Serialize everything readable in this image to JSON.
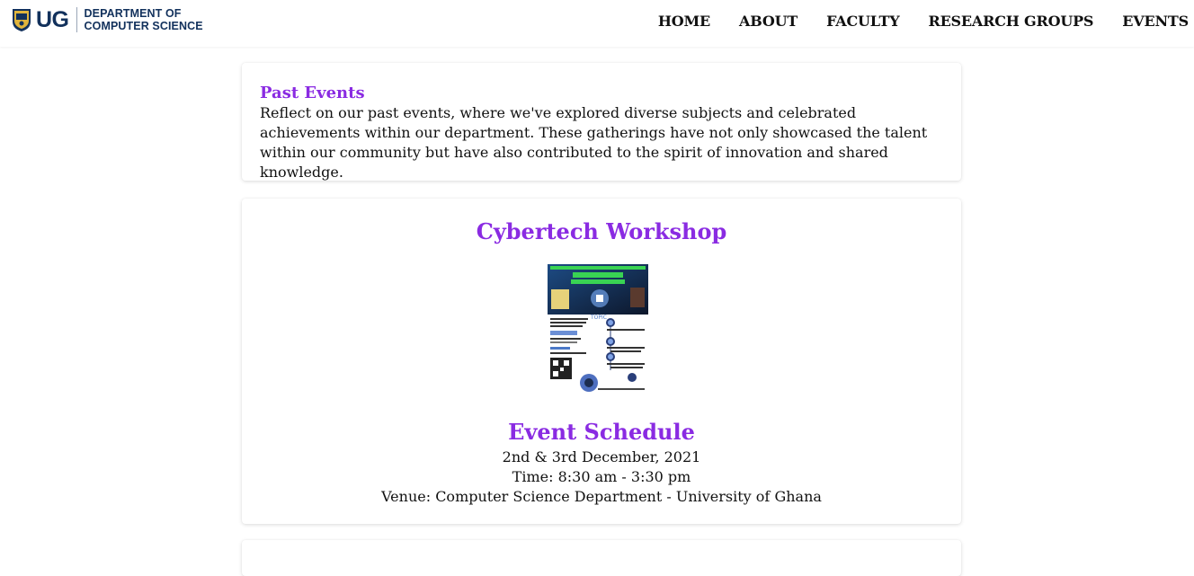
{
  "header": {
    "logo_abbr": "UG",
    "dept_line1": "DEPARTMENT OF",
    "dept_line2": "COMPUTER SCIENCE",
    "nav": [
      "HOME",
      "ABOUT",
      "FACULTY",
      "RESEARCH GROUPS",
      "EVENTS"
    ]
  },
  "intro": {
    "title": "Past Events",
    "body": "Reflect on our past events, where we've explored diverse subjects and celebrated achievements within our department. These gatherings have not only showcased the talent within our community but have also contributed to the spirit of innovation and shared knowledge."
  },
  "event": {
    "title": "Cybertech Workshop",
    "poster": {
      "headline1": "UNIVERSITY OF GHANA IN COLLABORATION WITH",
      "headline2": "GLOBAL CYBERTECH",
      "headline3": "WORKSHOP IN GHANA",
      "topic_label": "TOPIC",
      "topics": [
        "Cybersecurity Governance",
        "Cybersecurity Assessment / Penetration Testing",
        "Digital Forensics & Cybercrime Investigation"
      ],
      "registration_label": "Registration"
    },
    "schedule_title": "Event Schedule",
    "date": "2nd & 3rd December, 2021",
    "time": "Time: 8:30 am - 3:30 pm",
    "venue": "Venue: Computer Science Department - University of Ghana"
  },
  "colors": {
    "accent": "#8a2be2",
    "brand_navy": "#12315c"
  }
}
